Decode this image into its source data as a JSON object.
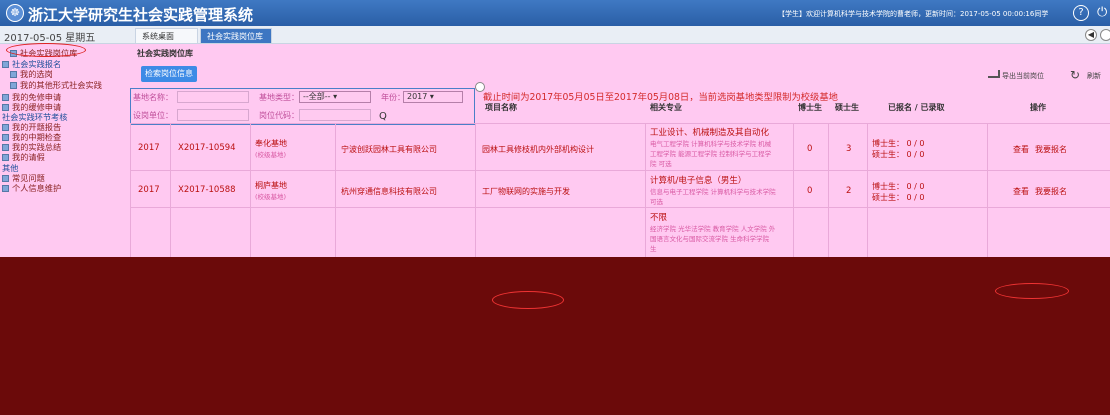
{
  "header": {
    "logo_glyph": "☸",
    "title": "浙江大学研究生社会实践管理系统",
    "welcome": "【学生】欢迎计算机科学与技术学院的曹老师，更新时间：2017-05-05 00:00:16同学",
    "help_glyph": "?",
    "power_glyph": "⏻"
  },
  "tabrow": {
    "date": "2017-05-05 星期五",
    "tabs": [
      {
        "label": "系统桌面"
      },
      {
        "label": "社会实践岗位库"
      }
    ],
    "close_glyph": "✖",
    "nav_left_glyph": "◀"
  },
  "sidebar": {
    "items": [
      {
        "label": "社会实践岗位库",
        "group": false
      },
      {
        "label": "社会实践报名",
        "group": true
      },
      {
        "label": "我的选岗",
        "group": false
      },
      {
        "label": "我的其他形式社会实践",
        "group": false
      },
      {
        "label": "我的免修申请",
        "group": false
      },
      {
        "label": "我的缓修申请",
        "group": false
      },
      {
        "label": "社会实践环节考核",
        "group": true
      },
      {
        "label": "我的开题报告",
        "group": false
      },
      {
        "label": "我的中期检查",
        "group": false
      },
      {
        "label": "我的实践总结",
        "group": false
      },
      {
        "label": "我的请假",
        "group": false
      },
      {
        "label": "其他",
        "group": true
      },
      {
        "label": "常见问题",
        "group": false
      },
      {
        "label": "个人信息维护",
        "group": false
      }
    ]
  },
  "main": {
    "title": "社会实践岗位库",
    "search_button": "检索岗位信息",
    "export_label": "导出当前岗位",
    "refresh_glyph": "↻",
    "refresh_label": "刷新",
    "filter": {
      "base_name_label": "基地名称：",
      "base_type_label": "基地类型：",
      "base_type_value": "--全部--",
      "year_label": "年份：",
      "year_value": "2017",
      "unit_label": "设岗单位：",
      "code_label": "岗位代码：",
      "search_glyph": "Q"
    },
    "notice": "截止时间为2017年05月05日至2017年05月08日，当前选岗基地类型限制为校级基地",
    "columns": {
      "project": "项目名称",
      "major": "相关专业",
      "phd": "博士生",
      "master": "硕士生",
      "applied": "已报名 / 已录取",
      "op": "操作"
    },
    "rows": [
      {
        "year": "2017",
        "code": "X2017-10594",
        "base": "奉化基地",
        "base_sub": "(校级基地)",
        "unit": "宁波创跃园林工具有限公司",
        "project": "园林工具修枝机内外部机构设计",
        "major": "工业设计、机械制造及其自动化",
        "major_sub1": "电气工程学院 计算机科学与技术学院 机械",
        "major_sub2": "工程学院 能源工程学院 控制科学与工程学",
        "major_sub3": "院 可选",
        "phd": "0",
        "master": "3",
        "phd_applied": "博士生：  0 / 0",
        "master_applied": "硕士生：  0 / 0",
        "view": "查看",
        "apply": "我要报名"
      },
      {
        "year": "2017",
        "code": "X2017-10588",
        "base": "桐庐基地",
        "base_sub": "(校级基地)",
        "unit": "杭州穿通信息科技有限公司",
        "project": "工厂物联网的实施与开发",
        "major": "计算机/电子信息（男生）",
        "major_sub1": "信息与电子工程学院 计算机科学与技术学院",
        "major_sub2": "可选",
        "phd": "0",
        "master": "2",
        "phd_applied": "博士生：  0 / 0",
        "master_applied": "硕士生：  0 / 0",
        "view": "查看",
        "apply": "我要报名"
      },
      {
        "major": "不限",
        "major_sub1": "经济学院 光华法学院 教育学院 人文学院 外",
        "major_sub2": "国语言文化与国际交流学院 生命科学学院",
        "major_sub3": "生"
      }
    ]
  }
}
